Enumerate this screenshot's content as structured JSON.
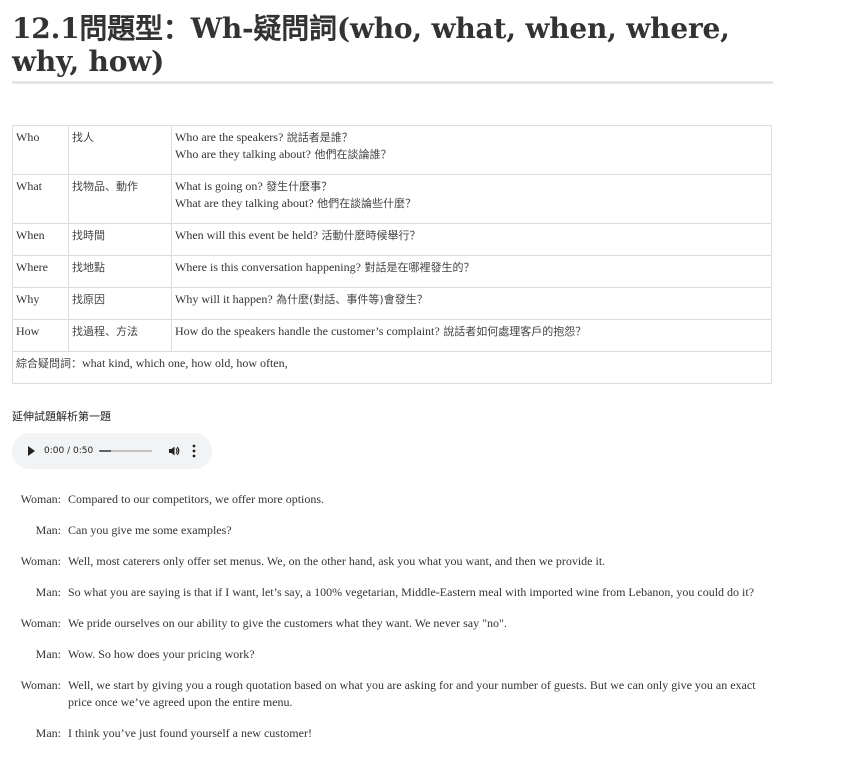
{
  "heading": {
    "title": "12.1問題型：Wh-疑問詞(who, what, when, where, why, how)"
  },
  "table": {
    "rows": [
      {
        "word": "Who",
        "goal": "找人",
        "lines": [
          {
            "en": "Who are the speakers?",
            "zh": " 說話者是誰？"
          },
          {
            "en": "Who are they talking about?",
            "zh": " 他們在談論誰？"
          }
        ]
      },
      {
        "word": "What",
        "goal": "找物品、動作",
        "lines": [
          {
            "en": "What is going on?",
            "zh": " 發生什麼事？"
          },
          {
            "en": "What are they talking about?",
            "zh": " 他們在談論些什麼？"
          }
        ]
      },
      {
        "word": "When",
        "goal": "找時間",
        "lines": [
          {
            "en": "When will this event be held?",
            "zh": " 活動什麼時候舉行？"
          }
        ]
      },
      {
        "word": "Where",
        "goal": "找地點",
        "lines": [
          {
            "en": "Where is this conversation happening?",
            "zh": " 對話是在哪裡發生的？"
          }
        ]
      },
      {
        "word": "Why",
        "goal": "找原因",
        "lines": [
          {
            "en": "Why will it happen?",
            "zh": " 為什麼(對話、事件等)會發生？"
          }
        ]
      },
      {
        "word": "How",
        "goal": "找過程、方法",
        "lines": [
          {
            "en": "How do the speakers handle the customer’s complaint?",
            "zh": " 說話者如何處理客戶的抱怨？"
          }
        ]
      }
    ],
    "footer": {
      "zh": "綜合疑問詞：",
      "en": "what kind, which one, how old, how often,"
    }
  },
  "section": {
    "label": "延伸試題解析第一題"
  },
  "audio": {
    "time": "0:00 / 0:50",
    "progress": 0,
    "play_icon": "play-icon",
    "volume_icon": "volume-icon",
    "menu_icon": "more-vert-icon"
  },
  "dialog": [
    {
      "speaker": "Woman:",
      "text": "Compared to our competitors, we offer more options."
    },
    {
      "speaker": "Man:",
      "text": "Can you give me some examples?"
    },
    {
      "speaker": "Woman:",
      "text": "Well, most caterers only offer set menus. We, on the other hand, ask you what you want, and then we provide it."
    },
    {
      "speaker": "Man:",
      "text": "So what you are saying is that if I want, let’s say, a 100% vegetarian, Middle-Eastern meal with imported wine from Lebanon, you could do it?"
    },
    {
      "speaker": "Woman:",
      "text": "We pride ourselves on our ability to give the customers what they want. We never say \"no\"."
    },
    {
      "speaker": "Man:",
      "text": "Wow. So how does your pricing work?"
    },
    {
      "speaker": "Woman:",
      "text": "Well, we start by giving you a rough quotation based on what you are asking for and your number of guests. But we can only give you an exact price once we’ve agreed upon the entire menu."
    },
    {
      "speaker": "Man:",
      "text": "I think you’ve just found yourself a new customer!"
    }
  ]
}
